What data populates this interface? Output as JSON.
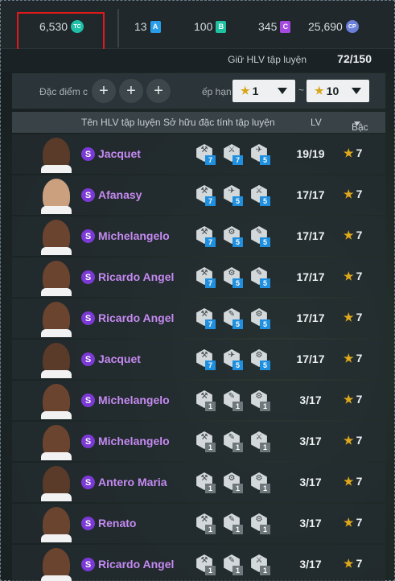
{
  "currencies": {
    "tc": {
      "value": "6,530",
      "icon": "tc-coin-icon",
      "label": "TC",
      "color": "#1fbfa8"
    },
    "a": {
      "value": "13",
      "label": "A",
      "color": "#2a9de8"
    },
    "b": {
      "value": "100",
      "label": "B",
      "color": "#1fc2a0"
    },
    "c": {
      "value": "345",
      "label": "C",
      "color": "#a44ae0"
    },
    "cp": {
      "value": "25,690",
      "label": "CP",
      "color": "#6a7fd9"
    }
  },
  "hold": {
    "label": "Giữ HLV tập luyện",
    "value": "72/150"
  },
  "filter": {
    "trait_label": "Đặc điểm c",
    "rank_label": "ếp hạn",
    "from_value": "1",
    "to_value": "10",
    "separator": "~"
  },
  "table": {
    "col_name": "Tên HLV tập luyện",
    "col_traits": "Sở hữu đặc tính tập luyện",
    "col_lv": "LV",
    "col_grade": "Bậc"
  },
  "badge_label": "S",
  "rows": [
    {
      "name": "Jacquet",
      "lv": "19/19",
      "grade": "7",
      "skin": "#5a3a28",
      "traits": [
        {
          "g": "⚒",
          "l": "7",
          "c": "#1f8fe0"
        },
        {
          "g": "⚔",
          "l": "7",
          "c": "#1f8fe0"
        },
        {
          "g": "✈",
          "l": "5",
          "c": "#1f8fe0"
        }
      ]
    },
    {
      "name": "Afanasy",
      "lv": "17/17",
      "grade": "7",
      "skin": "#caa07e",
      "traits": [
        {
          "g": "⚒",
          "l": "7",
          "c": "#1f8fe0"
        },
        {
          "g": "✈",
          "l": "5",
          "c": "#1f8fe0"
        },
        {
          "g": "⚔",
          "l": "5",
          "c": "#1f8fe0"
        }
      ]
    },
    {
      "name": "Michelangelo",
      "lv": "17/17",
      "grade": "7",
      "skin": "#6b4430",
      "traits": [
        {
          "g": "⚒",
          "l": "7",
          "c": "#1f8fe0"
        },
        {
          "g": "⚙",
          "l": "5",
          "c": "#1f8fe0"
        },
        {
          "g": "✎",
          "l": "5",
          "c": "#1f8fe0"
        }
      ]
    },
    {
      "name": "Ricardo Angel",
      "lv": "17/17",
      "grade": "7",
      "skin": "#6b4430",
      "traits": [
        {
          "g": "⚒",
          "l": "7",
          "c": "#1f8fe0"
        },
        {
          "g": "⚙",
          "l": "5",
          "c": "#1f8fe0"
        },
        {
          "g": "✎",
          "l": "5",
          "c": "#1f8fe0"
        }
      ]
    },
    {
      "name": "Ricardo Angel",
      "lv": "17/17",
      "grade": "7",
      "skin": "#6b4430",
      "traits": [
        {
          "g": "⚒",
          "l": "7",
          "c": "#1f8fe0"
        },
        {
          "g": "✎",
          "l": "5",
          "c": "#1f8fe0"
        },
        {
          "g": "⚙",
          "l": "5",
          "c": "#1f8fe0"
        }
      ]
    },
    {
      "name": "Jacquet",
      "lv": "17/17",
      "grade": "7",
      "skin": "#5a3a28",
      "traits": [
        {
          "g": "⚒",
          "l": "7",
          "c": "#1f8fe0"
        },
        {
          "g": "✈",
          "l": "5",
          "c": "#1f8fe0"
        },
        {
          "g": "⚙",
          "l": "5",
          "c": "#1f8fe0"
        }
      ]
    },
    {
      "name": "Michelangelo",
      "lv": "3/17",
      "grade": "7",
      "skin": "#6b4430",
      "traits": [
        {
          "g": "⚒",
          "l": "1",
          "c": "#6e777b"
        },
        {
          "g": "✎",
          "l": "1",
          "c": "#6e777b"
        },
        {
          "g": "⚙",
          "l": "1",
          "c": "#6e777b"
        }
      ]
    },
    {
      "name": "Michelangelo",
      "lv": "3/17",
      "grade": "7",
      "skin": "#6b4430",
      "traits": [
        {
          "g": "⚒",
          "l": "1",
          "c": "#6e777b"
        },
        {
          "g": "✎",
          "l": "1",
          "c": "#6e777b"
        },
        {
          "g": "⚔",
          "l": "1",
          "c": "#6e777b"
        }
      ]
    },
    {
      "name": "Antero Maria",
      "lv": "3/17",
      "grade": "7",
      "skin": "#5a3a28",
      "traits": [
        {
          "g": "⚒",
          "l": "1",
          "c": "#6e777b"
        },
        {
          "g": "⚙",
          "l": "1",
          "c": "#6e777b"
        },
        {
          "g": "⚙",
          "l": "1",
          "c": "#6e777b"
        }
      ]
    },
    {
      "name": "Renato",
      "lv": "3/17",
      "grade": "7",
      "skin": "#6b4430",
      "traits": [
        {
          "g": "⚒",
          "l": "1",
          "c": "#6e777b"
        },
        {
          "g": "✎",
          "l": "1",
          "c": "#6e777b"
        },
        {
          "g": "⚙",
          "l": "1",
          "c": "#6e777b"
        }
      ]
    },
    {
      "name": "Ricardo Angel",
      "lv": "3/17",
      "grade": "7",
      "skin": "#6b4430",
      "traits": [
        {
          "g": "⚒",
          "l": "1",
          "c": "#6e777b"
        },
        {
          "g": "✎",
          "l": "1",
          "c": "#6e777b"
        },
        {
          "g": "⚔",
          "l": "1",
          "c": "#6e777b"
        }
      ]
    }
  ]
}
